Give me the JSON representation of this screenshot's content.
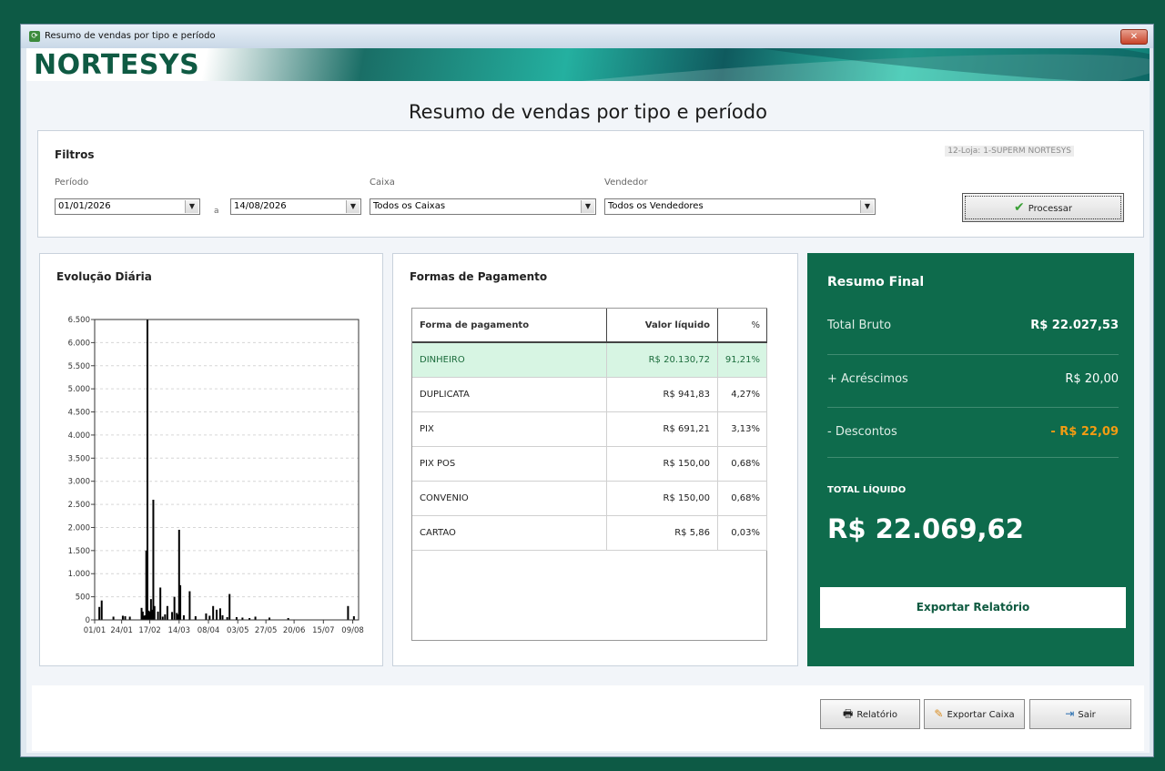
{
  "window": {
    "title": "Resumo de vendas por tipo e período",
    "close_label": "✕"
  },
  "banner": {
    "logo": "NORTESYS"
  },
  "page_title": "Resumo de vendas por tipo e período",
  "filters": {
    "header": "Filtros",
    "store_label": "12-Loja: 1-SUPERM NORTESYS",
    "period_label": "Período",
    "date_from": "01/01/2026",
    "separator": "a",
    "date_to": "14/08/2026",
    "cashier_label": "Caixa",
    "cashier_value": "Todos os Caixas",
    "seller_label": "Vendedor",
    "seller_value": "Todos os Vendedores",
    "process_button": "Processar"
  },
  "evolution": {
    "header": "Evolução Diária"
  },
  "chart_data": {
    "type": "bar",
    "title": "",
    "xlabel": "",
    "ylabel": "",
    "xlim": [
      "01/01",
      "14/08"
    ],
    "ylim": [
      0,
      6500
    ],
    "grid": true,
    "y_ticks": [
      "0",
      "500",
      "1.000",
      "1.500",
      "2.000",
      "2.500",
      "3.000",
      "3.500",
      "4.000",
      "4.500",
      "5.000",
      "5.500",
      "6.000",
      "6.500"
    ],
    "x_ticks": [
      "01/01",
      "24/01",
      "17/02",
      "14/03",
      "08/04",
      "03/05",
      "27/05",
      "20/06",
      "15/07",
      "09/08"
    ],
    "x": [
      "05/01",
      "07/01",
      "17/01",
      "25/01",
      "27/01",
      "31/01",
      "10/02",
      "11/02",
      "12/02",
      "13/02",
      "14/02",
      "15/02",
      "16/02",
      "17/02",
      "18/02",
      "19/02",
      "20/02",
      "21/02",
      "24/02",
      "26/02",
      "28/02",
      "02/03",
      "04/03",
      "08/03",
      "10/03",
      "12/03",
      "13/03",
      "14/03",
      "15/03",
      "18/03",
      "23/03",
      "28/03",
      "06/04",
      "09/04",
      "12/04",
      "15/04",
      "18/04",
      "20/04",
      "24/04",
      "26/04",
      "02/05",
      "07/05",
      "13/05",
      "18/05",
      "30/05",
      "15/06",
      "05/08",
      "10/08"
    ],
    "values": [
      280,
      420,
      70,
      90,
      80,
      70,
      260,
      180,
      90,
      100,
      1500,
      6500,
      200,
      180,
      450,
      220,
      2600,
      300,
      180,
      700,
      70,
      120,
      300,
      170,
      500,
      150,
      120,
      1950,
      750,
      100,
      620,
      80,
      140,
      90,
      300,
      220,
      250,
      100,
      60,
      560,
      60,
      50,
      40,
      70,
      50,
      40,
      300,
      80
    ]
  },
  "payments": {
    "header": "Formas de Pagamento",
    "columns": [
      "Forma de pagamento",
      "Valor líquido",
      "%"
    ],
    "rows": [
      {
        "name": "DINHEIRO",
        "value": "R$ 20.130,72",
        "pct": "91,21%"
      },
      {
        "name": "DUPLICATA",
        "value": "R$ 941,83",
        "pct": "4,27%"
      },
      {
        "name": "PIX",
        "value": "R$ 691,21",
        "pct": "3,13%"
      },
      {
        "name": "PIX POS",
        "value": "R$ 150,00",
        "pct": "0,68%"
      },
      {
        "name": "CONVENIO",
        "value": "R$ 150,00",
        "pct": "0,68%"
      },
      {
        "name": "CARTAO",
        "value": "R$ 5,86",
        "pct": "0,03%"
      }
    ]
  },
  "summary": {
    "header": "Resumo Final",
    "gross_label": "Total Bruto",
    "gross_value": "R$ 22.027,53",
    "additions_label": "+ Acréscimos",
    "additions_value": "R$ 20,00",
    "discounts_label": "- Descontos",
    "discounts_value": "- R$ 22,09",
    "net_label": "TOTAL LÍQUIDO",
    "net_value": "R$ 22.069,62",
    "export_button": "Exportar Relatório",
    "discount_color": "#f39c12"
  },
  "footer": {
    "report_button": "Relatório",
    "export_cash_button": "Exportar Caixa",
    "exit_button": "Sair"
  }
}
